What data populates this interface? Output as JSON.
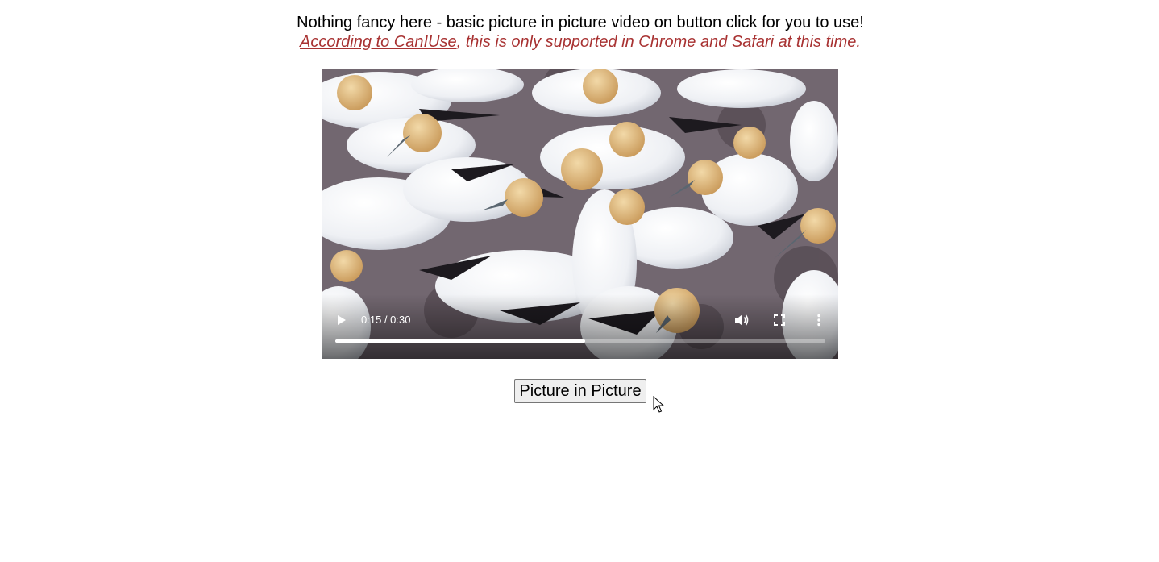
{
  "intro": {
    "text": "Nothing fancy here - basic picture in picture video on button click for you to use!",
    "link_text": "According to CanIUse",
    "note_rest": ", this is only supported in Chrome and Safari at this time."
  },
  "video": {
    "time_display": "0:15 / 0:30",
    "progress": 0.51,
    "icons": {
      "play": "play-icon",
      "volume": "volume-icon",
      "fullscreen": "fullscreen-icon",
      "more": "more-options-icon"
    }
  },
  "button": {
    "label": "Picture in Picture"
  },
  "colors": {
    "note": "#a83232",
    "page_bg": "#ffffff"
  }
}
